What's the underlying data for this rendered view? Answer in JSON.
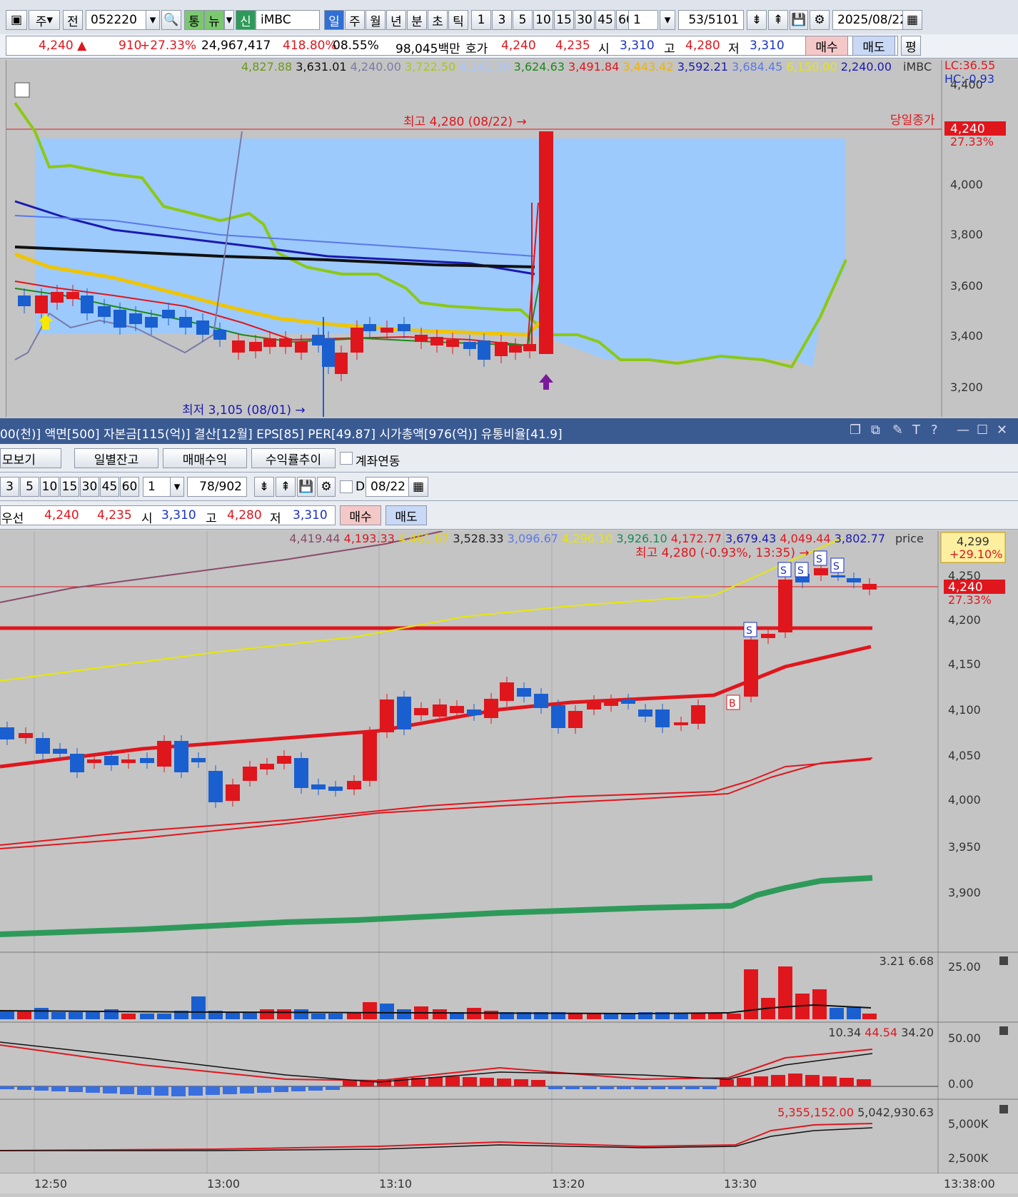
{
  "toolbar": {
    "period_labels": [
      "주",
      "전"
    ],
    "code": "052220",
    "tabs": [
      "통",
      "뉴",
      "신"
    ],
    "name": "iMBC",
    "interval_tabs": [
      "일",
      "주",
      "월",
      "년",
      "분",
      "초",
      "틱"
    ],
    "multipliers": [
      "1",
      "3",
      "5",
      "10",
      "15",
      "30",
      "45",
      "60"
    ],
    "mult_value": "1",
    "count": "53",
    "total": "/5101",
    "date": "2025/08/22"
  },
  "quote": {
    "price": "4,240 ▲",
    "change": "910",
    "pct": "+27.33%",
    "volume": "24,967,417",
    "vol_ratio": "418.80%",
    "turnover": "08.55%",
    "amount": "98,045백만",
    "hoga_label": "호가",
    "ask": "4,240",
    "bid": "4,235",
    "open_label": "시",
    "open": "3,310",
    "high_label": "고",
    "high": "4,280",
    "low_label": "저",
    "low": "3,310",
    "buy": "매수",
    "sell": "매도",
    "avg": "평"
  },
  "daily_chart": {
    "legend_values": [
      {
        "text": "4,827.88",
        "color": "#6a9a1a"
      },
      {
        "text": "3,631.01",
        "color": "#111111"
      },
      {
        "text": "4,240.00",
        "color": "#7a7aa8"
      },
      {
        "text": "3,722.50",
        "color": "#a8c814"
      },
      {
        "text": "4,142.30",
        "color": "#a8c8ff"
      },
      {
        "text": "3,624.63",
        "color": "#1a8a1a"
      },
      {
        "text": "3,491.84",
        "color": "#e0161d"
      },
      {
        "text": "3,443.42",
        "color": "#f0b400"
      },
      {
        "text": "3,592.21",
        "color": "#1a1ab0"
      },
      {
        "text": "3,684.45",
        "color": "#5a78e8"
      },
      {
        "text": "6,150.00",
        "color": "#e8e800"
      },
      {
        "text": "2,240.00",
        "color": "#1a1ab0"
      }
    ],
    "legend_name": "iMBC",
    "lc": "LC:36.55",
    "hc": "HC:-0.93",
    "high_note": "최고 4,280 (08/22)",
    "low_note": "최저 3,105 (08/01)",
    "close_label": "당일종가",
    "price_tag": "4,240",
    "pct_tag": "27.33%",
    "yticks": [
      "4,400",
      "4,000",
      "3,800",
      "3,600",
      "3,400",
      "3,200"
    ]
  },
  "info_bar": {
    "text": "00(천)] 액면[500] 자본금[115(억)] 결산[12월] EPS[85] PER[49.87] 시가총액[976(억)] 유통비율[41.9]"
  },
  "panel_buttons": [
    "모보기",
    "일별잔고",
    "매매수익",
    "수익률추이"
  ],
  "checkbox_label": "계좌연동",
  "minute_toolbar": {
    "multipliers": [
      "3",
      "5",
      "10",
      "15",
      "30",
      "45",
      "60"
    ],
    "mult_value": "1",
    "count": "78",
    "total": "/902",
    "d_label": "D",
    "date": "08/22"
  },
  "minute_quote": {
    "label": "우선",
    "ask": "4,240",
    "bid": "4,235",
    "open_label": "시",
    "open": "3,310",
    "high_label": "고",
    "high": "4,280",
    "low_label": "저",
    "low": "3,310",
    "buy": "매수",
    "sell": "매도"
  },
  "minute_chart": {
    "legend_values": [
      {
        "text": "4,419.44",
        "color": "#8a4a6a"
      },
      {
        "text": "4,193.33",
        "color": "#e0161d"
      },
      {
        "text": "4,461.67",
        "color": "#e8d800"
      },
      {
        "text": "3,528.33",
        "color": "#222222"
      },
      {
        "text": "3,096.67",
        "color": "#5a78e8"
      },
      {
        "text": "4,296.10",
        "color": "#e8e800"
      },
      {
        "text": "3,926.10",
        "color": "#1a8a5a"
      },
      {
        "text": "4,172.77",
        "color": "#e0161d"
      },
      {
        "text": "3,679.43",
        "color": "#1a1ab0"
      },
      {
        "text": "4,049.44",
        "color": "#e0161d"
      },
      {
        "text": "3,802.77",
        "color": "#1a1ab0"
      }
    ],
    "legend_name": "price",
    "high_note": "최고 4,280 (-0.93%, 13:35)",
    "top_tag": "4,299",
    "top_pct": "+29.10%",
    "price_tag": "4,240",
    "pct_tag": "27.33%",
    "yticks": [
      "4,250",
      "4,200",
      "4,150",
      "4,100",
      "4,050",
      "4,000",
      "3,950",
      "3,900"
    ],
    "xticks": [
      "12:50",
      "13:00",
      "13:10",
      "13:20",
      "13:30",
      "13:38:00"
    ]
  },
  "volume_pane": {
    "legend": "3.21 6.68",
    "ytick": "25.00"
  },
  "macd_pane": {
    "legend_a": "10.34",
    "legend_b": "44.54",
    "legend_c": "34.20",
    "yticks": [
      "50.00",
      "0.00"
    ]
  },
  "obv_pane": {
    "legend_a": "5,355,152.00",
    "legend_b": "5,042,930.63",
    "yticks": [
      "5,000K",
      "2,500K"
    ]
  },
  "window_controls": [
    "restore",
    "cascade",
    "pin",
    "text",
    "help",
    "minimize",
    "maximize",
    "close"
  ],
  "colors": {
    "up": "#e0161d",
    "down": "#1a5fd0",
    "cloud": "#9ccafc",
    "header_blue": "#3a5a92"
  }
}
